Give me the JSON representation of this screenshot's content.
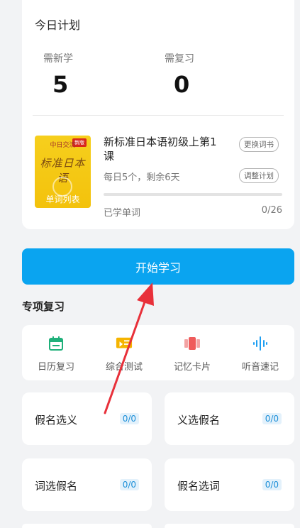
{
  "plan": {
    "title": "今日计划",
    "new_label": "需新学",
    "new_count": "5",
    "review_label": "需复习",
    "review_count": "0"
  },
  "book": {
    "cover_badge": "新版",
    "cover_top": "中日交流",
    "cover_script": "标准日本语",
    "cover_list": "单词列表",
    "title": "新标准日本语初级上第1课",
    "change_book": "更换词书",
    "schedule": "每日5个，剩余6天",
    "adjust_plan": "调整计划",
    "progress_label": "已学单词",
    "progress_count": "0/26",
    "progress_fraction": 0
  },
  "start_button": "开始学习",
  "special_review": {
    "title": "专项复习",
    "tools": [
      {
        "label": "日历复习",
        "icon": "calendar-icon"
      },
      {
        "label": "综合测试",
        "icon": "test-icon"
      },
      {
        "label": "记忆卡片",
        "icon": "flashcard-icon"
      },
      {
        "label": "听音速记",
        "icon": "audio-wave-icon"
      }
    ]
  },
  "drills": [
    {
      "label": "假名选义",
      "count": "0/0"
    },
    {
      "label": "义选假名",
      "count": "0/0"
    },
    {
      "label": "词选假名",
      "count": "0/0"
    },
    {
      "label": "假名选词",
      "count": "0/0"
    }
  ],
  "colors": {
    "accent": "#0aa4f0",
    "annotation_arrow": "#e8303a",
    "calendar_icon": "#1fb07a",
    "test_icon": "#f5b400",
    "flashcard_icon": "#ef5b5b",
    "audio_icon": "#1e9ff2"
  }
}
